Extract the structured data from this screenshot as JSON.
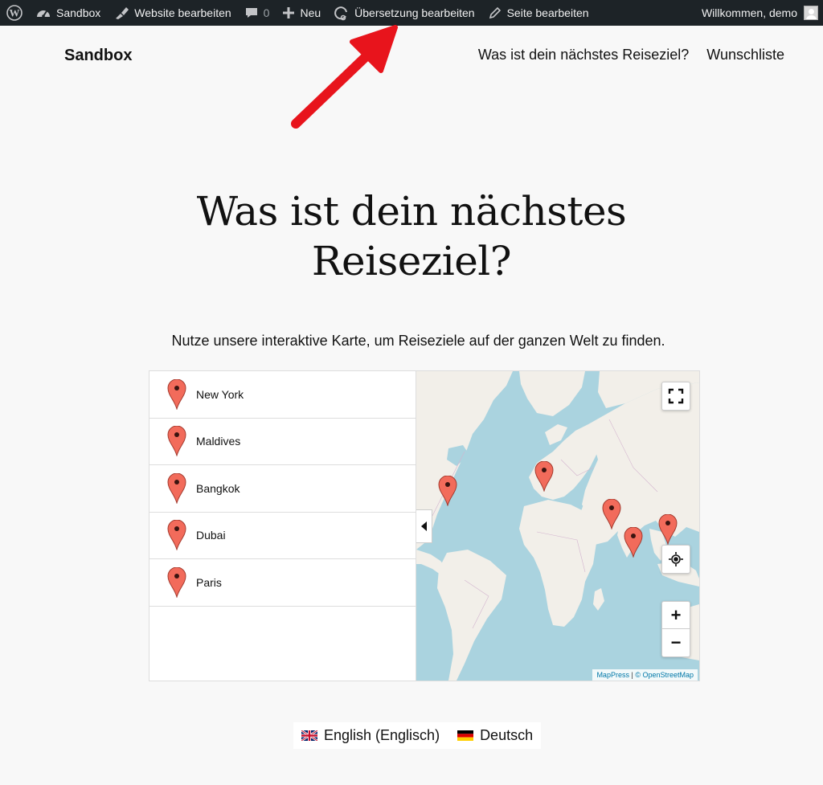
{
  "adminbar": {
    "site_name": "Sandbox",
    "edit_site": "Website bearbeiten",
    "comment_count": "0",
    "new_label": "Neu",
    "edit_translation": "Übersetzung bearbeiten",
    "edit_page": "Seite bearbeiten",
    "greeting": "Willkommen, demo"
  },
  "header": {
    "site_title": "Sandbox",
    "nav": [
      "Was ist dein nächstes Reiseziel?",
      "Wunschliste"
    ]
  },
  "page": {
    "title_line1": "Was ist dein nächstes",
    "title_line2": "Reiseziel?",
    "lead": "Nutze unsere interaktive Karte, um Reiseziele auf der ganzen Welt zu finden."
  },
  "map": {
    "locations": [
      "New York",
      "Maldives",
      "Bangkok",
      "Dubai",
      "Paris"
    ],
    "attribution_provider": "MapPress",
    "attribution_separator": "|",
    "attribution_osm": "© OpenStreetMap",
    "zoom_in": "+",
    "zoom_out": "−",
    "pin_color": "#f26b5b",
    "water_color": "#aad3df",
    "land_color": "#f2efe9"
  },
  "languages": [
    {
      "label": "English (Englisch)",
      "flag": "uk-flag-icon"
    },
    {
      "label": "Deutsch",
      "flag": "germany-flag-icon"
    }
  ]
}
